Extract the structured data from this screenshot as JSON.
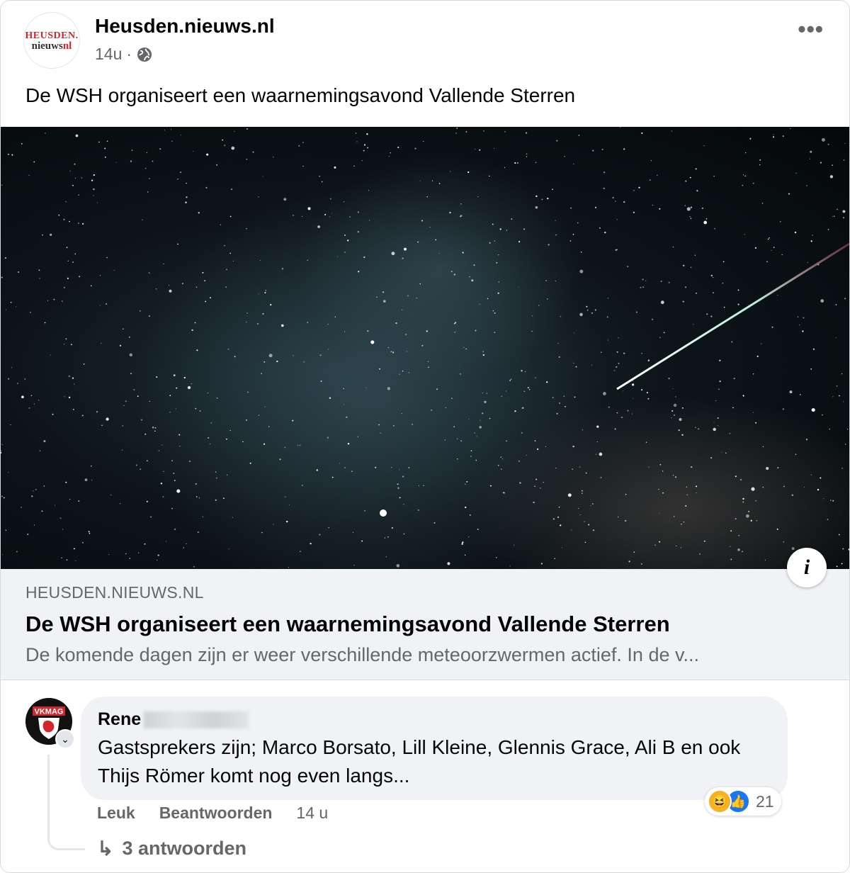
{
  "post": {
    "page_name": "Heusden.nieuws.nl",
    "logo": {
      "line1": "HEUSDEN.",
      "line2_a": "nieuws",
      "line2_b": "nl"
    },
    "time": "14u",
    "separator": "·",
    "privacy_icon": "globe-icon",
    "more_icon": "more-options-icon",
    "more_glyph": "•••",
    "text": "De WSH organiseert een waarnemingsavond Vallende Sterren"
  },
  "image": {
    "subject": "starry-night-sky-with-meteor",
    "info_glyph": "i"
  },
  "link_preview": {
    "domain": "HEUSDEN.NIEUWS.NL",
    "title": "De WSH organiseert een waarnemingsavond Vallende Sterren",
    "description": "De komende dagen zijn er weer verschillende meteoorzwermen actief. In de v..."
  },
  "comment": {
    "avatar_text": "VKMAG",
    "badge_glyph": "⌄",
    "author": "Rene",
    "text": "Gastsprekers zijn; Marco Borsato, Lill Kleine, Glennis Grace, Ali B en ook Thijs Römer komt nog even langs...",
    "reactions": {
      "haha_glyph": "😆",
      "like_glyph": "👍",
      "count": "21"
    },
    "actions": {
      "like": "Leuk",
      "reply": "Beantwoorden",
      "time": "14 u"
    },
    "replies": {
      "arrow": "↳",
      "label": "3 antwoorden"
    }
  },
  "colors": {
    "text_primary": "#050505",
    "text_secondary": "#65676b",
    "bubble_bg": "#f0f2f5",
    "brand_red": "#d3252c",
    "like_blue": "#1877f2",
    "haha_yellow": "#f7b125"
  }
}
